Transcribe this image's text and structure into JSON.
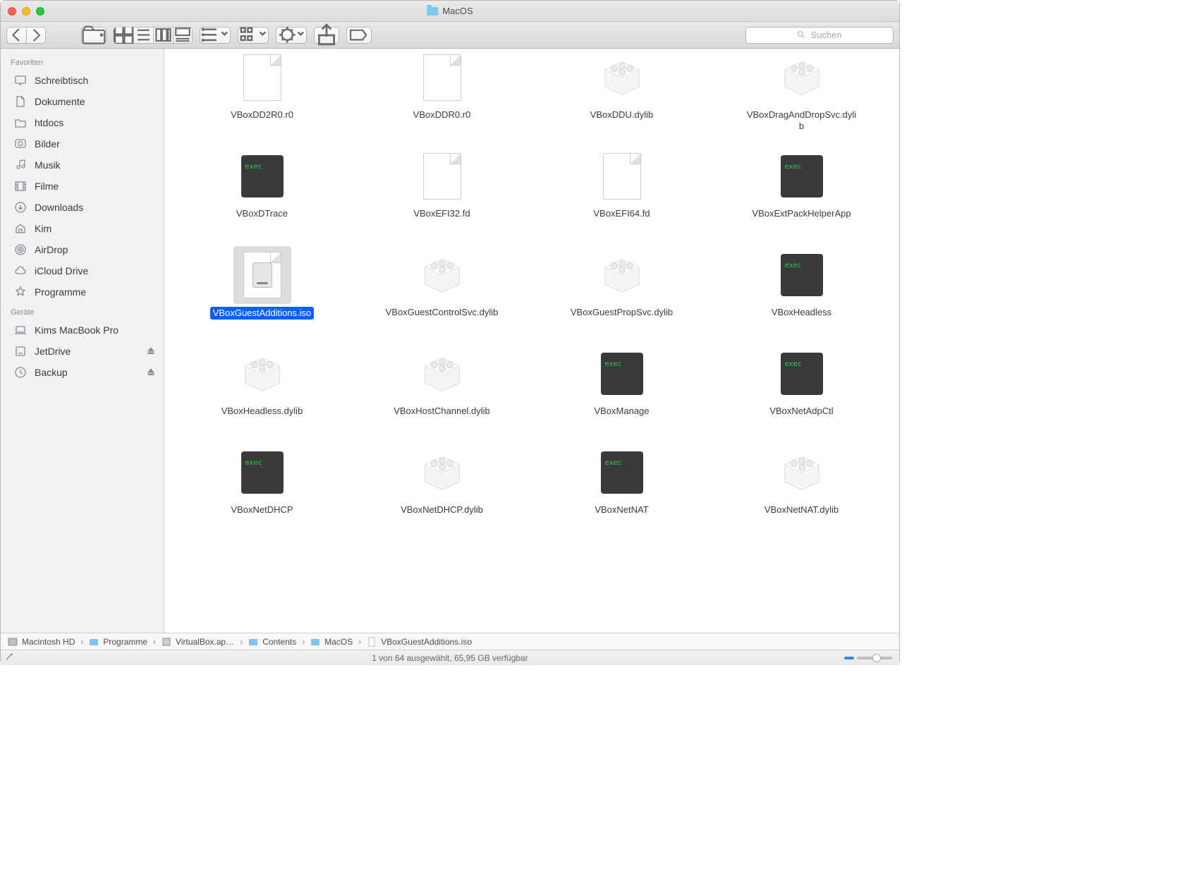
{
  "window_title": "MacOS",
  "search_placeholder": "Suchen",
  "sidebar": {
    "sections": [
      {
        "label": "Favoriten",
        "items": [
          {
            "label": "Schreibtisch",
            "icon": "desktop"
          },
          {
            "label": "Dokumente",
            "icon": "documents"
          },
          {
            "label": "htdocs",
            "icon": "folder"
          },
          {
            "label": "Bilder",
            "icon": "photos"
          },
          {
            "label": "Musik",
            "icon": "music"
          },
          {
            "label": "Filme",
            "icon": "movies"
          },
          {
            "label": "Downloads",
            "icon": "downloads"
          },
          {
            "label": "Kim",
            "icon": "home"
          },
          {
            "label": "AirDrop",
            "icon": "airdrop"
          },
          {
            "label": "iCloud Drive",
            "icon": "cloud"
          },
          {
            "label": "Programme",
            "icon": "apps"
          }
        ]
      },
      {
        "label": "Geräte",
        "items": [
          {
            "label": "Kims MacBook Pro",
            "icon": "laptop"
          },
          {
            "label": "JetDrive",
            "icon": "drive",
            "eject": true
          },
          {
            "label": "Backup",
            "icon": "timemachine",
            "eject": true
          }
        ]
      }
    ]
  },
  "files": [
    {
      "label": "VBoxDD2R0.r0",
      "type": "doc"
    },
    {
      "label": "VBoxDDR0.r0",
      "type": "doc"
    },
    {
      "label": "VBoxDDU.dylib",
      "type": "bundle"
    },
    {
      "label": "VBoxDragAndDropSvc.dylib",
      "type": "bundle"
    },
    {
      "label": "VBoxDTrace",
      "type": "exec"
    },
    {
      "label": "VBoxEFI32.fd",
      "type": "doc"
    },
    {
      "label": "VBoxEFI64.fd",
      "type": "doc"
    },
    {
      "label": "VBoxExtPackHelperApp",
      "type": "exec"
    },
    {
      "label": "VBoxGuestAdditions.iso",
      "type": "iso",
      "selected": true
    },
    {
      "label": "VBoxGuestControlSvc.dylib",
      "type": "bundle"
    },
    {
      "label": "VBoxGuestPropSvc.dylib",
      "type": "bundle"
    },
    {
      "label": "VBoxHeadless",
      "type": "exec"
    },
    {
      "label": "VBoxHeadless.dylib",
      "type": "bundle"
    },
    {
      "label": "VBoxHostChannel.dylib",
      "type": "bundle"
    },
    {
      "label": "VBoxManage",
      "type": "exec"
    },
    {
      "label": "VBoxNetAdpCtl",
      "type": "exec"
    },
    {
      "label": "VBoxNetDHCP",
      "type": "exec"
    },
    {
      "label": "VBoxNetDHCP.dylib",
      "type": "bundle"
    },
    {
      "label": "VBoxNetNAT",
      "type": "exec"
    },
    {
      "label": "VBoxNetNAT.dylib",
      "type": "bundle"
    }
  ],
  "path": [
    "Macintosh HD",
    "Programme",
    "VirtualBox.ap…",
    "Contents",
    "MacOS",
    "VBoxGuestAdditions.iso"
  ],
  "status_text": "1 von 64 ausgewählt, 65,95 GB verfügbar"
}
